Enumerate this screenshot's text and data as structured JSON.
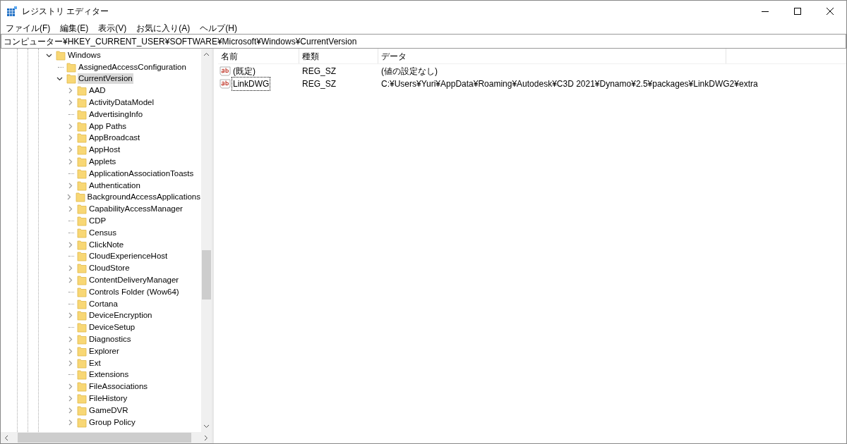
{
  "window": {
    "title": "レジストリ エディター"
  },
  "menu": [
    "ファイル(F)",
    "編集(E)",
    "表示(V)",
    "お気に入り(A)",
    "ヘルプ(H)"
  ],
  "address": "コンピューター¥HKEY_CURRENT_USER¥SOFTWARE¥Microsoft¥Windows¥CurrentVersion",
  "tree": [
    {
      "label": "Windows",
      "expandable": true,
      "expanded": true,
      "selected": false,
      "children": [
        {
          "label": "AssignedAccessConfiguration",
          "expandable": false,
          "selected": false
        },
        {
          "label": "CurrentVersion",
          "expandable": true,
          "expanded": true,
          "selected": true,
          "children": [
            {
              "label": "AAD",
              "expandable": true,
              "expanded": false,
              "selected": false
            },
            {
              "label": "ActivityDataModel",
              "expandable": true,
              "expanded": false,
              "selected": false
            },
            {
              "label": "AdvertisingInfo",
              "expandable": false,
              "selected": false
            },
            {
              "label": "App Paths",
              "expandable": true,
              "expanded": false,
              "selected": false
            },
            {
              "label": "AppBroadcast",
              "expandable": true,
              "expanded": false,
              "selected": false
            },
            {
              "label": "AppHost",
              "expandable": true,
              "expanded": false,
              "selected": false
            },
            {
              "label": "Applets",
              "expandable": true,
              "expanded": false,
              "selected": false
            },
            {
              "label": "ApplicationAssociationToasts",
              "expandable": false,
              "selected": false
            },
            {
              "label": "Authentication",
              "expandable": true,
              "expanded": false,
              "selected": false
            },
            {
              "label": "BackgroundAccessApplications",
              "expandable": true,
              "expanded": false,
              "selected": false
            },
            {
              "label": "CapabilityAccessManager",
              "expandable": true,
              "expanded": false,
              "selected": false
            },
            {
              "label": "CDP",
              "expandable": false,
              "selected": false
            },
            {
              "label": "Census",
              "expandable": false,
              "selected": false
            },
            {
              "label": "ClickNote",
              "expandable": true,
              "expanded": false,
              "selected": false
            },
            {
              "label": "CloudExperienceHost",
              "expandable": false,
              "selected": false
            },
            {
              "label": "CloudStore",
              "expandable": true,
              "expanded": false,
              "selected": false
            },
            {
              "label": "ContentDeliveryManager",
              "expandable": true,
              "expanded": false,
              "selected": false
            },
            {
              "label": "Controls Folder (Wow64)",
              "expandable": false,
              "selected": false
            },
            {
              "label": "Cortana",
              "expandable": false,
              "selected": false
            },
            {
              "label": "DeviceEncryption",
              "expandable": true,
              "expanded": false,
              "selected": false
            },
            {
              "label": "DeviceSetup",
              "expandable": false,
              "selected": false
            },
            {
              "label": "Diagnostics",
              "expandable": true,
              "expanded": false,
              "selected": false
            },
            {
              "label": "Explorer",
              "expandable": true,
              "expanded": false,
              "selected": false
            },
            {
              "label": "Ext",
              "expandable": true,
              "expanded": false,
              "selected": false
            },
            {
              "label": "Extensions",
              "expandable": false,
              "selected": false
            },
            {
              "label": "FileAssociations",
              "expandable": true,
              "expanded": false,
              "selected": false
            },
            {
              "label": "FileHistory",
              "expandable": true,
              "expanded": false,
              "selected": false
            },
            {
              "label": "GameDVR",
              "expandable": true,
              "expanded": false,
              "selected": false
            },
            {
              "label": "Group Policy",
              "expandable": true,
              "expanded": false,
              "selected": false
            }
          ]
        }
      ]
    }
  ],
  "table": {
    "columns": [
      "名前",
      "種類",
      "データ"
    ],
    "rows": [
      {
        "name": "(既定)",
        "type": "REG_SZ",
        "data": "(値の設定なし)",
        "focused": false
      },
      {
        "name": "LinkDWG",
        "type": "REG_SZ",
        "data": "C:¥Users¥Yuri¥AppData¥Roaming¥Autodesk¥C3D 2021¥Dynamo¥2.5¥packages¥LinkDWG2¥extra",
        "focused": true
      }
    ]
  }
}
